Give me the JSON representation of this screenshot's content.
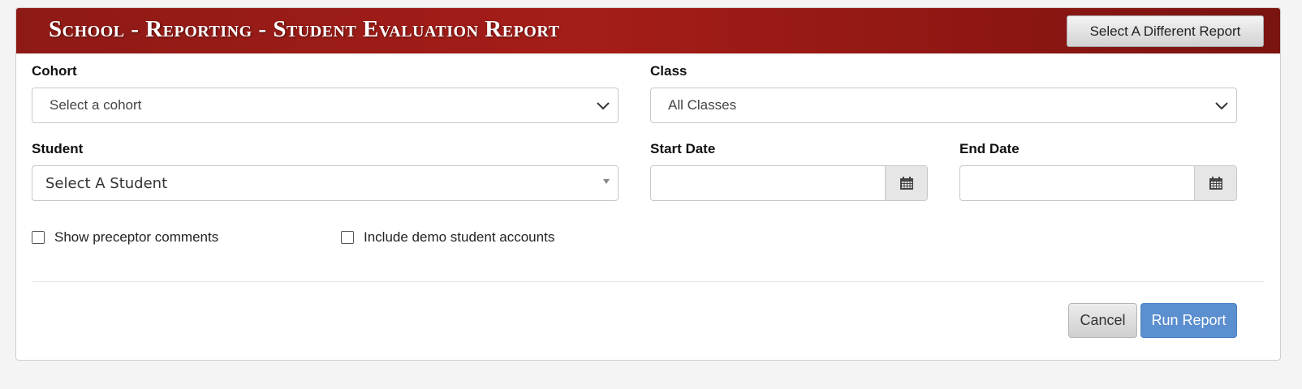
{
  "header": {
    "title": "School - Reporting - Student Evaluation Report",
    "select_different_report": "Select A Different Report",
    "color": "#a51d18"
  },
  "form": {
    "cohort": {
      "label": "Cohort",
      "value": "Select a cohort"
    },
    "class": {
      "label": "Class",
      "value": "All Classes"
    },
    "student": {
      "label": "Student",
      "value": "Select A Student"
    },
    "start_date": {
      "label": "Start Date",
      "value": ""
    },
    "end_date": {
      "label": "End Date",
      "value": ""
    },
    "show_preceptor_comments": {
      "label": "Show preceptor comments",
      "checked": false
    },
    "include_demo_accounts": {
      "label": "Include demo student accounts",
      "checked": false
    }
  },
  "actions": {
    "cancel": "Cancel",
    "run_report": "Run Report",
    "run_color": "#5b8fcf"
  },
  "icons": {
    "dropdown": "chevron-down-icon",
    "calendar": "calendar-icon"
  }
}
